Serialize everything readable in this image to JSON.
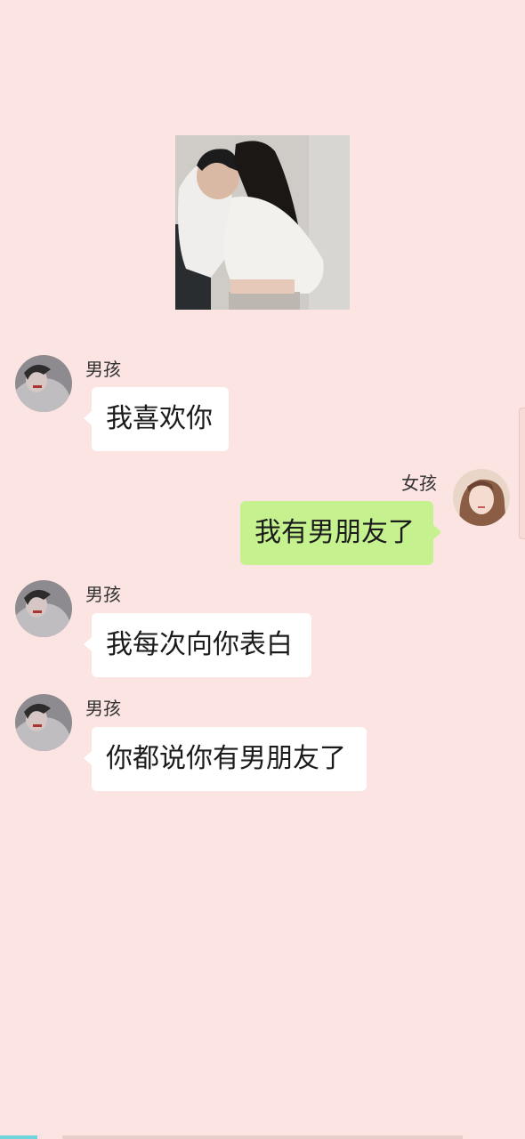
{
  "chat": {
    "shared_image": {
      "icon": "couple-photo"
    },
    "messages": [
      {
        "sender": "男孩",
        "side": "left",
        "text": "我喜欢你",
        "avatar_icon": "boy-avatar-icon"
      },
      {
        "sender": "女孩",
        "side": "right",
        "text": "我有男朋友了",
        "avatar_icon": "girl-avatar-icon"
      },
      {
        "sender": "男孩",
        "side": "left",
        "text": "我每次向你表白",
        "avatar_icon": "boy-avatar-icon"
      },
      {
        "sender": "男孩",
        "side": "left",
        "text": "你都说你有男朋友了",
        "avatar_icon": "boy-avatar-icon"
      }
    ]
  },
  "colors": {
    "background": "#fbe4e1",
    "bubble_left": "#ffffff",
    "bubble_right": "#c5f18f",
    "progress_accent": "#6fd4dc"
  }
}
